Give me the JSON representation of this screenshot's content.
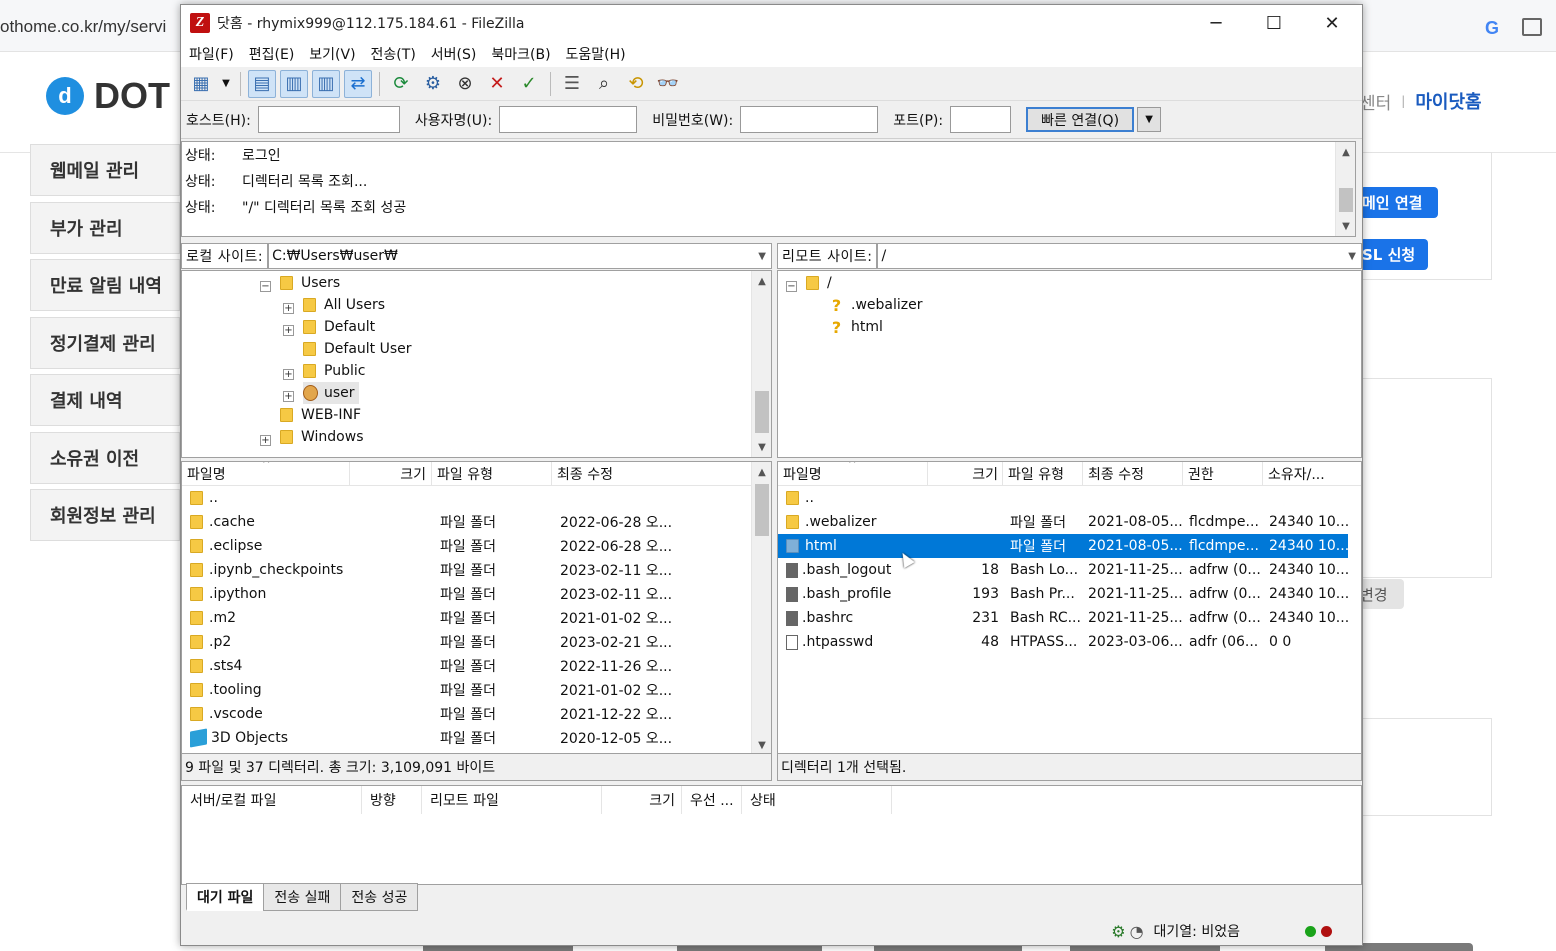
{
  "browser": {
    "url_fragment": "othome.co.kr/my/servi",
    "g_icon": "G"
  },
  "site": {
    "logo_text": "DOT",
    "nav_center": "센터",
    "nav_my": "마이닷홈",
    "side_menu": [
      "웹메일 관리",
      "부가 관리",
      "만료 알림 내역",
      "정기결제 관리",
      "결제 내역",
      "소유권 이전",
      "회원정보 관리"
    ],
    "btn_domain": "메인 연결",
    "btn_ssl": "SL 신청",
    "btn_change": "변경"
  },
  "window": {
    "title": "닷홈 - rhymix999@112.175.184.61 - FileZilla",
    "controls": {
      "minimize": "─",
      "maximize": "☐",
      "close": "✕"
    },
    "menu": [
      "파일(F)",
      "편집(E)",
      "보기(V)",
      "전송(T)",
      "서버(S)",
      "북마크(B)",
      "도움말(H)"
    ]
  },
  "quickconnect": {
    "host_label": "호스트(H):",
    "host_value": "",
    "user_label": "사용자명(U):",
    "user_value": "",
    "pass_label": "비밀번호(W):",
    "pass_value": "",
    "port_label": "포트(P):",
    "port_value": "",
    "button": "빠른 연결(Q)"
  },
  "log": [
    {
      "label": "상태:",
      "text": "로그인"
    },
    {
      "label": "상태:",
      "text": "디렉터리 목록 조회..."
    },
    {
      "label": "상태:",
      "text": "\"/\" 디렉터리 목록 조회 성공"
    }
  ],
  "local": {
    "site_label": "로컬 사이트:",
    "path": "C:₩Users₩user₩",
    "tree": [
      "Users",
      "All Users",
      "Default",
      "Default User",
      "Public",
      "user",
      "WEB-INF",
      "Windows"
    ],
    "columns": [
      "파일명",
      "크기",
      "파일 유형",
      "최종 수정"
    ],
    "files": [
      {
        "name": "..",
        "size": "",
        "type": "",
        "date": ""
      },
      {
        "name": ".cache",
        "size": "",
        "type": "파일 폴더",
        "date": "2022-06-28 오..."
      },
      {
        "name": ".eclipse",
        "size": "",
        "type": "파일 폴더",
        "date": "2022-06-28 오..."
      },
      {
        "name": ".ipynb_checkpoints",
        "size": "",
        "type": "파일 폴더",
        "date": "2023-02-11 오..."
      },
      {
        "name": ".ipython",
        "size": "",
        "type": "파일 폴더",
        "date": "2023-02-11 오..."
      },
      {
        "name": ".m2",
        "size": "",
        "type": "파일 폴더",
        "date": "2021-01-02 오..."
      },
      {
        "name": ".p2",
        "size": "",
        "type": "파일 폴더",
        "date": "2023-02-21 오..."
      },
      {
        "name": ".sts4",
        "size": "",
        "type": "파일 폴더",
        "date": "2022-11-26 오..."
      },
      {
        "name": ".tooling",
        "size": "",
        "type": "파일 폴더",
        "date": "2021-01-02 오..."
      },
      {
        "name": ".vscode",
        "size": "",
        "type": "파일 폴더",
        "date": "2021-12-22 오..."
      },
      {
        "name": "3D Objects",
        "size": "",
        "type": "파일 폴더",
        "date": "2020-12-05 오..."
      }
    ],
    "status": "9 파일 및 37 디렉터리. 총 크기: 3,109,091 바이트"
  },
  "remote": {
    "site_label": "리모트 사이트:",
    "path": "/",
    "tree": [
      "/",
      ".webalizer",
      "html"
    ],
    "columns": [
      "파일명",
      "크기",
      "파일 유형",
      "최종 수정",
      "권한",
      "소유자/..."
    ],
    "files": [
      {
        "name": "..",
        "size": "",
        "type": "",
        "date": "",
        "perm": "",
        "owner": ""
      },
      {
        "name": ".webalizer",
        "size": "",
        "type": "파일 폴더",
        "date": "2021-08-05...",
        "perm": "flcdmpe...",
        "owner": "24340 10..."
      },
      {
        "name": "html",
        "size": "",
        "type": "파일 폴더",
        "date": "2021-08-05...",
        "perm": "flcdmpe...",
        "owner": "24340 10..."
      },
      {
        "name": ".bash_logout",
        "size": "18",
        "type": "Bash Lo...",
        "date": "2021-11-25...",
        "perm": "adfrw (0...",
        "owner": "24340 10..."
      },
      {
        "name": ".bash_profile",
        "size": "193",
        "type": "Bash Pr...",
        "date": "2021-11-25...",
        "perm": "adfrw (0...",
        "owner": "24340 10..."
      },
      {
        "name": ".bashrc",
        "size": "231",
        "type": "Bash RC...",
        "date": "2021-11-25...",
        "perm": "adfrw (0...",
        "owner": "24340 10..."
      },
      {
        "name": ".htpasswd",
        "size": "48",
        "type": "HTPASS...",
        "date": "2023-03-06...",
        "perm": "adfr (06...",
        "owner": "0 0"
      }
    ],
    "status": "디렉터리 1개 선택됨."
  },
  "queue": {
    "columns": [
      "서버/로컬 파일",
      "방향",
      "리모트 파일",
      "크기",
      "우선 ...",
      "상태"
    ],
    "tabs": [
      "대기 파일",
      "전송 실패",
      "전송 성공"
    ]
  },
  "statusbar": {
    "queue_text": "대기열: 비었음",
    "led_colors": [
      "#1aa31a",
      "#b01010"
    ]
  }
}
